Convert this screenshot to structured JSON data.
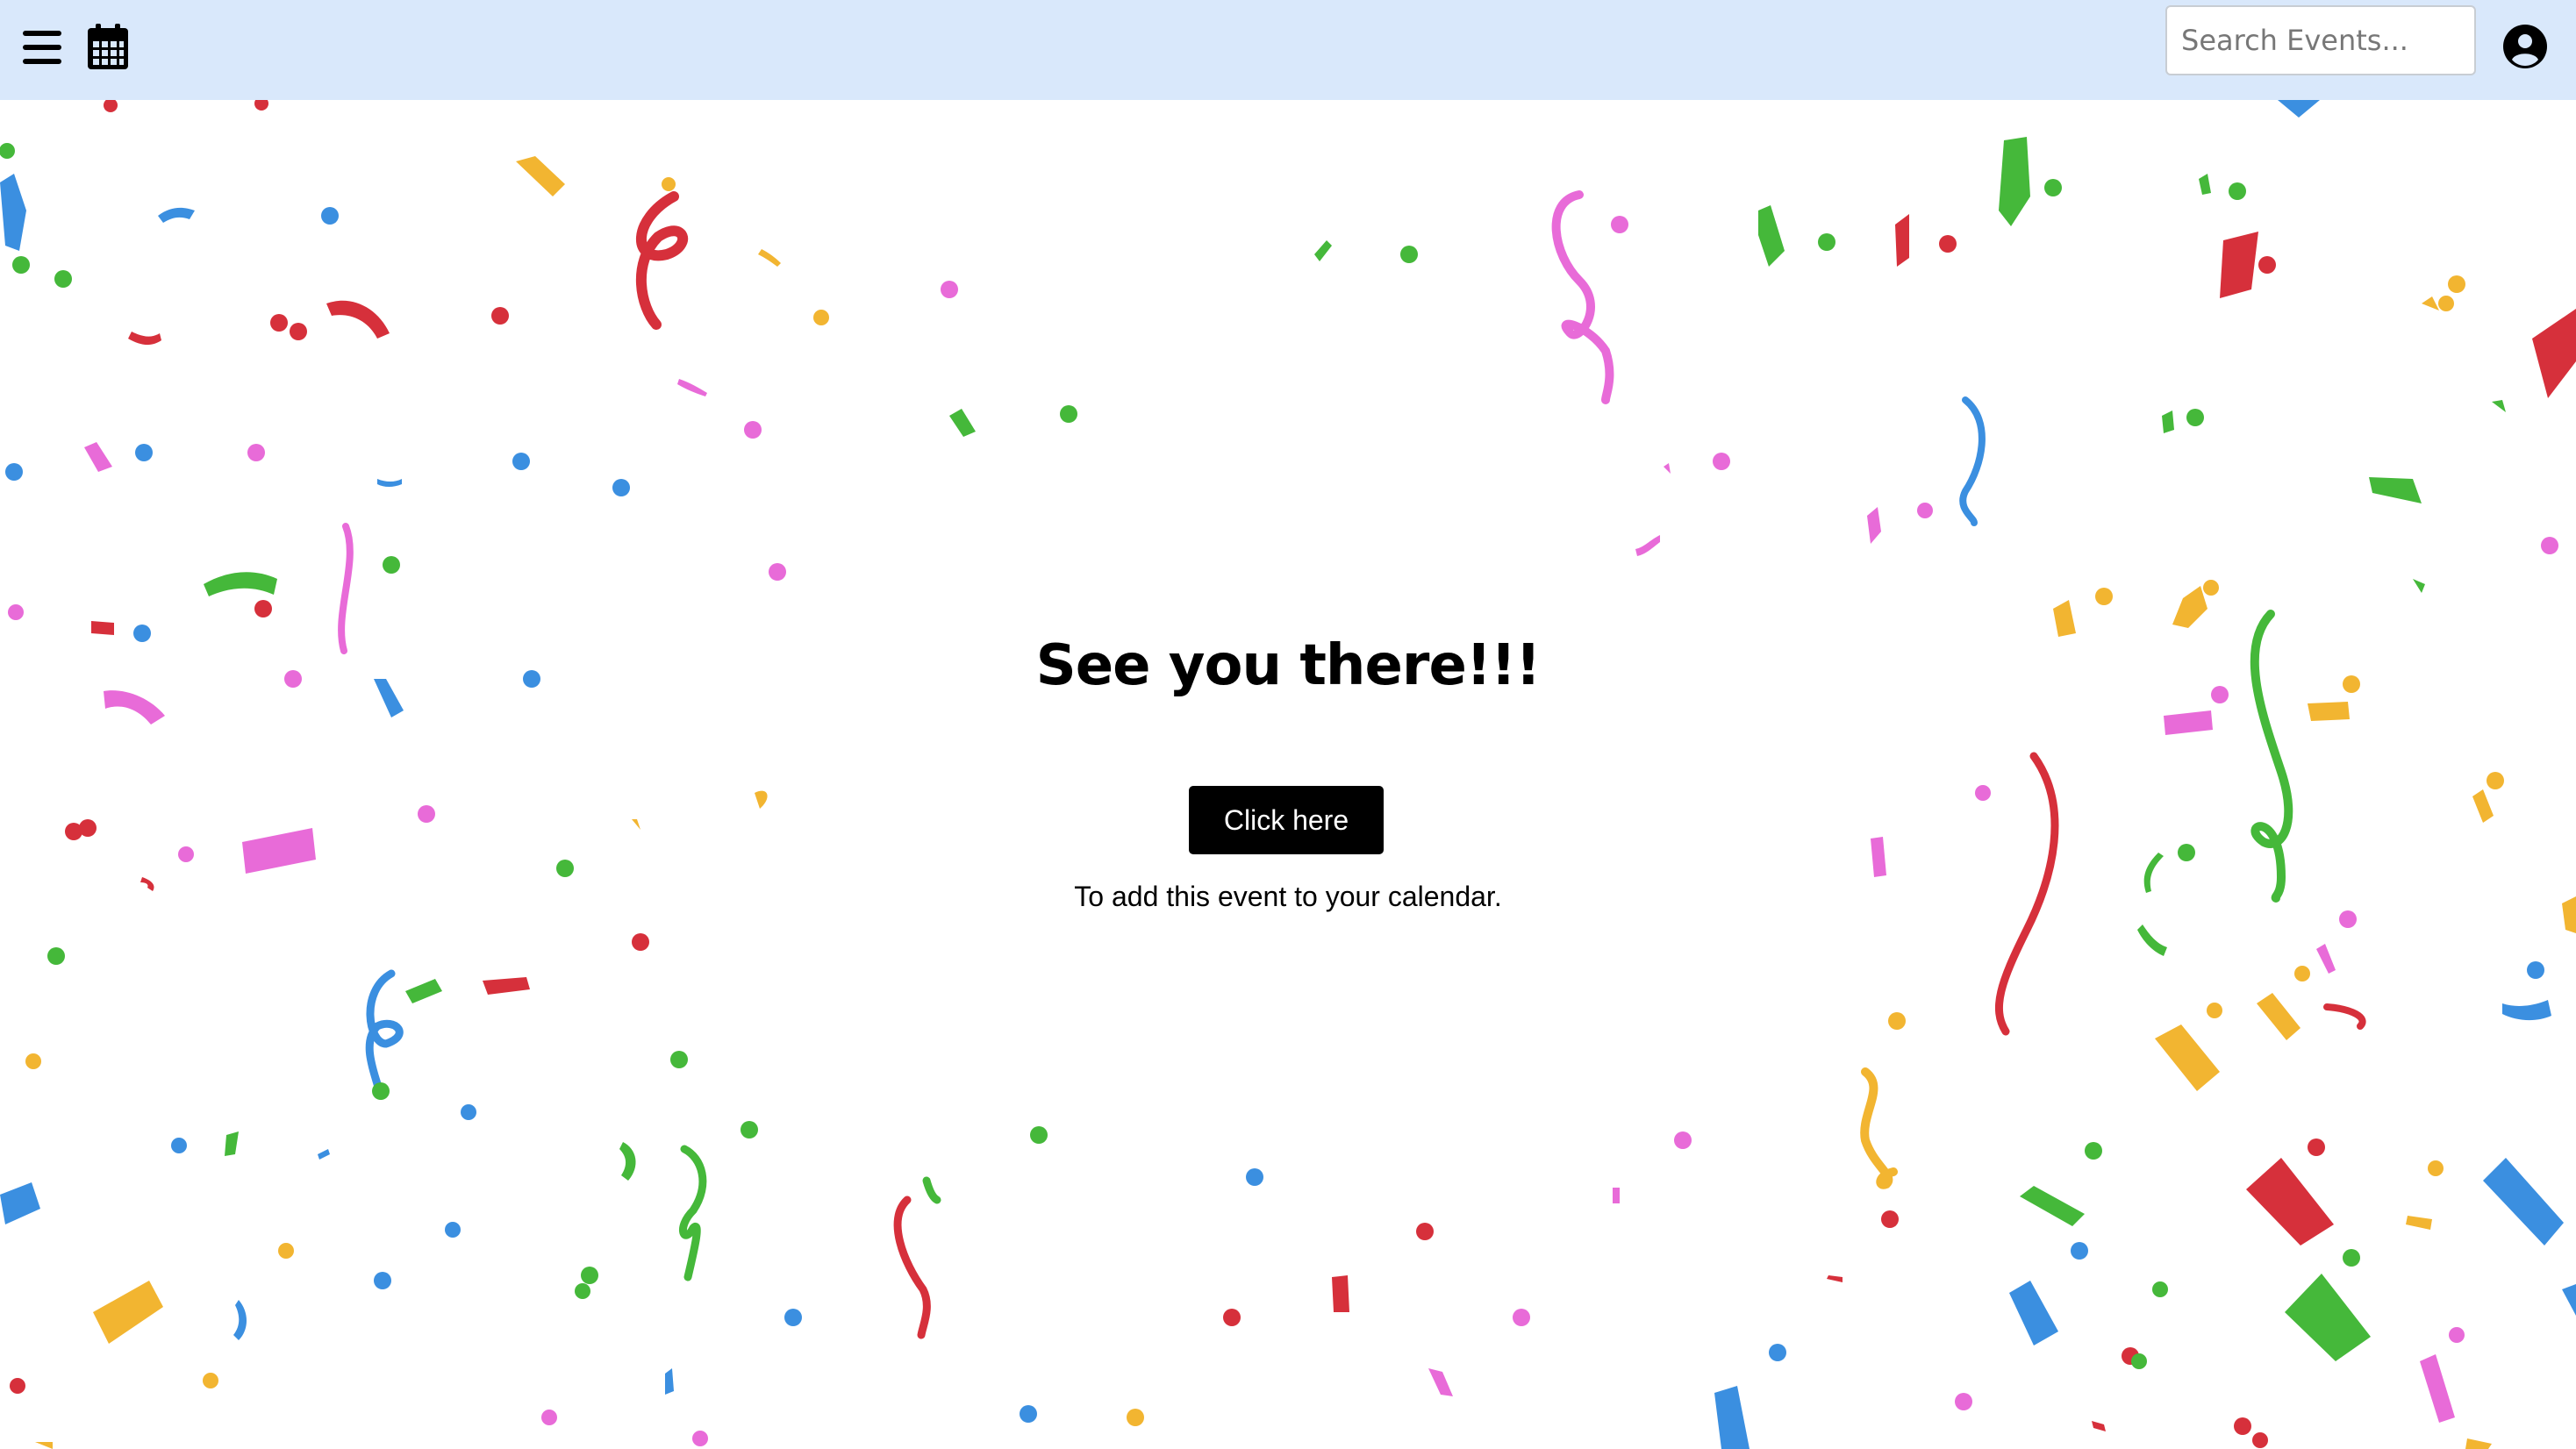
{
  "header": {
    "menu_icon": "hamburger-menu-icon",
    "calendar_icon": "calendar-icon",
    "search_placeholder": "Search Events...",
    "search_value": "",
    "account_icon": "user-circle-icon",
    "background_color": "#d9e8fb"
  },
  "main": {
    "title": "See you there!!!",
    "button_label": "Click here",
    "subtext": "To add this event to your calendar."
  },
  "theme": {
    "button_color": "#000000",
    "confetti_colors": [
      "#d6303b",
      "#3b8fe0",
      "#45b83a",
      "#e86bd8",
      "#f2b531"
    ]
  }
}
